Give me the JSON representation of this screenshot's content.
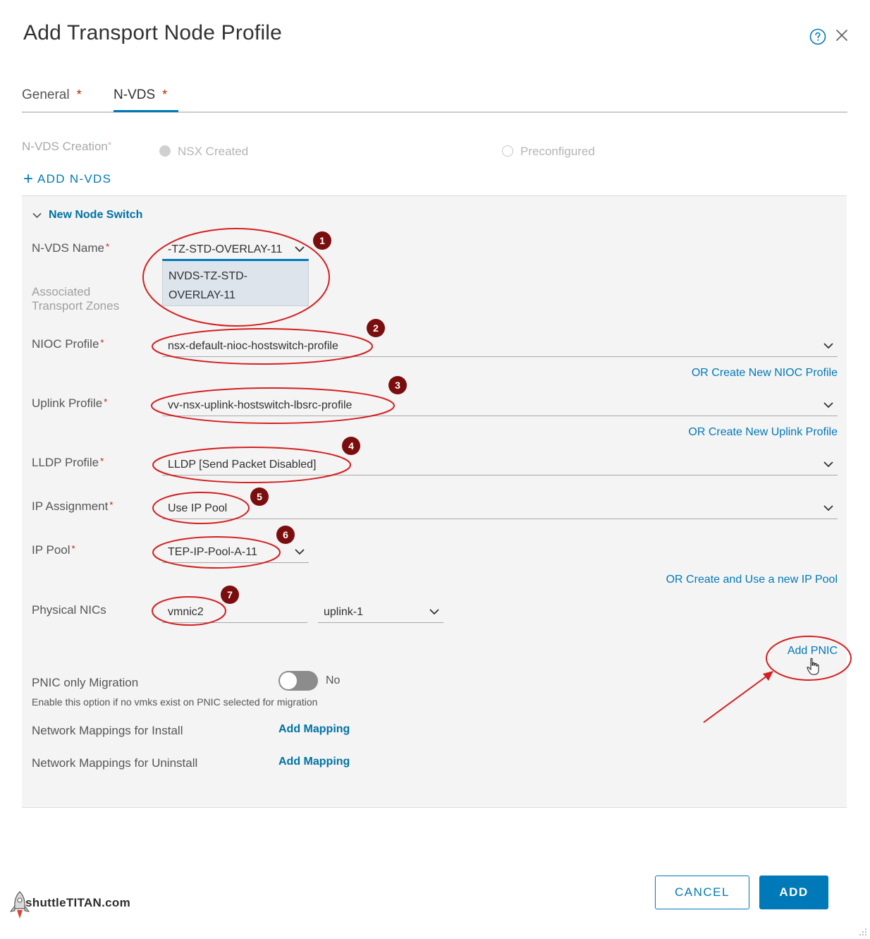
{
  "dialog": {
    "title": "Add Transport Node Profile",
    "help_icon": "help-circle-icon",
    "close_icon": "close-icon"
  },
  "tabs": [
    {
      "label": "General",
      "required": "*"
    },
    {
      "label": "N-VDS",
      "required": "*",
      "active": true
    }
  ],
  "creation": {
    "label": "N-VDS Creation",
    "required": "*",
    "options": [
      "NSX Created",
      "Preconfigured"
    ],
    "selected": "NSX Created"
  },
  "add_nvds": {
    "plus": "+",
    "label": "ADD N-VDS"
  },
  "switch_section": {
    "title": "New Node Switch",
    "fields": {
      "nvds_name": {
        "label": "N-VDS Name",
        "required": "*",
        "value": "-TZ-STD-OVERLAY-11",
        "dropdown_option_1": "NVDS-TZ-STD-",
        "dropdown_option_2": "OVERLAY-11"
      },
      "transport_zones": {
        "label_1": "Associated",
        "label_2": "Transport Zones"
      },
      "nioc": {
        "label": "NIOC Profile",
        "required": "*",
        "value": "nsx-default-nioc-hostswitch-profile",
        "create_link": "OR Create New NIOC Profile"
      },
      "uplink": {
        "label": "Uplink Profile",
        "required": "*",
        "value": "vv-nsx-uplink-hostswitch-lbsrc-profile",
        "create_link": "OR Create New Uplink Profile"
      },
      "lldp": {
        "label": "LLDP Profile",
        "required": "*",
        "value": "LLDP [Send Packet Disabled]"
      },
      "ip_assignment": {
        "label": "IP Assignment",
        "required": "*",
        "value": "Use IP Pool"
      },
      "ip_pool": {
        "label": "IP Pool",
        "required": "*",
        "value": "TEP-IP-Pool-A-11",
        "create_link": "OR Create and Use a new IP Pool"
      },
      "physical_nics": {
        "label": "Physical NICs",
        "nic_value": "vmnic2",
        "uplink_value": "uplink-1",
        "add_link": "Add PNIC"
      },
      "pnic_migration": {
        "label": "PNIC only Migration",
        "toggle_label": "No",
        "toggle_on": false,
        "help_text": "Enable this option if no vmks exist on PNIC selected for migration"
      },
      "mappings_install": {
        "label": "Network Mappings for Install",
        "link": "Add Mapping"
      },
      "mappings_uninstall": {
        "label": "Network Mappings for Uninstall",
        "link": "Add Mapping"
      }
    }
  },
  "footer": {
    "cancel_label": "CANCEL",
    "add_label": "ADD"
  },
  "watermark": {
    "text": "shuttleTITAN.com"
  },
  "annotations": {
    "badges": [
      "1",
      "2",
      "3",
      "4",
      "5",
      "6",
      "7"
    ],
    "color": "#d42020",
    "badge_color": "#7a0e0e"
  },
  "colors": {
    "accent": "#0079b8",
    "required": "#c21d00",
    "panel": "#f4f4f4"
  }
}
